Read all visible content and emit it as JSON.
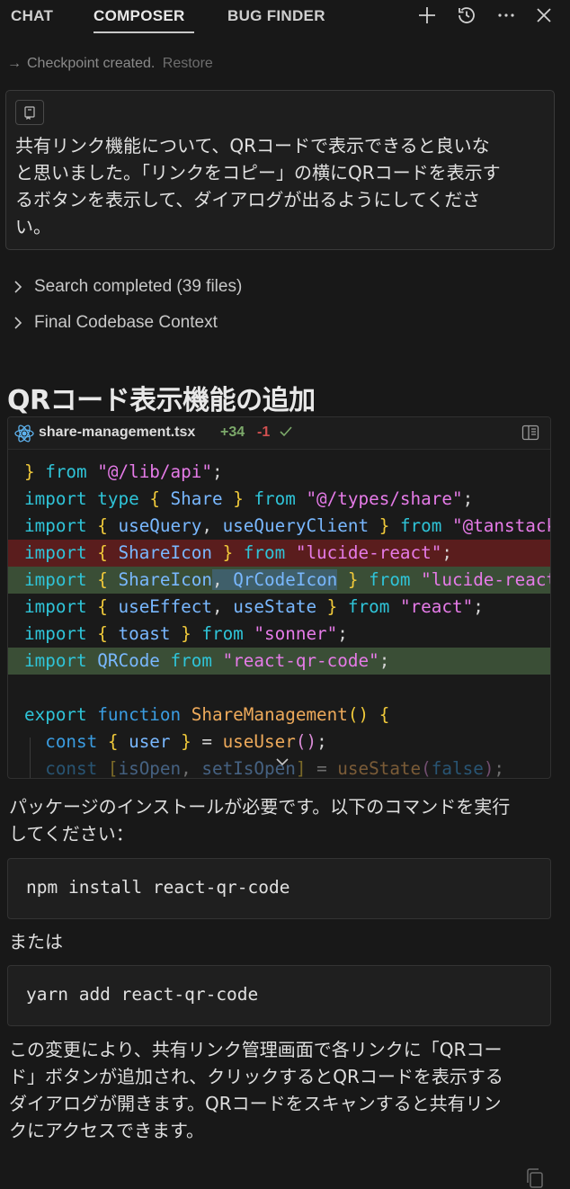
{
  "tabs": [
    {
      "label": "CHAT",
      "active": false
    },
    {
      "label": "COMPOSER",
      "active": true
    },
    {
      "label": "BUG FINDER",
      "active": false
    }
  ],
  "toolbar": {
    "icons": [
      "plus-icon",
      "history-icon",
      "more-icon",
      "close-icon"
    ]
  },
  "checkpoint": {
    "text": "Checkpoint created.",
    "restore_label": "Restore"
  },
  "prompt": {
    "lines": [
      "共有リンク機能について、QRコードで表示できると良いな",
      "と思いました。「リンクをコピー」の横にQRコードを表示す",
      "るボタンを表示して、ダイアログが出るようにしてくださ",
      "い。"
    ]
  },
  "steps": [
    {
      "label": "Search completed (39 files)"
    },
    {
      "label": "Final Codebase Context"
    }
  ],
  "section_title": "QRコード表示機能の追加",
  "code_file": {
    "filename": "share-management.tsx",
    "added": "+34",
    "removed": "-1"
  },
  "after_code_lines": [
    "パッケージのインストールが必要です。以下のコマンドを実行",
    "してください："
  ],
  "command1": "npm install react-qr-code",
  "or_text": "または",
  "command2": "yarn add react-qr-code",
  "summary_lines": [
    "この変更により、共有リンク管理画面で各リンクに「QRコー",
    "ド」ボタンが追加され、クリックするとQRコードを表示する",
    "ダイアログが開きます。QRコードをスキャンすると共有リン",
    "クにアクセスできます。"
  ],
  "colors": {
    "background": "#181818",
    "deleted_line": "#5a1d1d",
    "inserted_line": "#3a4e36",
    "added_count": "#7ca96a",
    "removed_count": "#d05050"
  }
}
